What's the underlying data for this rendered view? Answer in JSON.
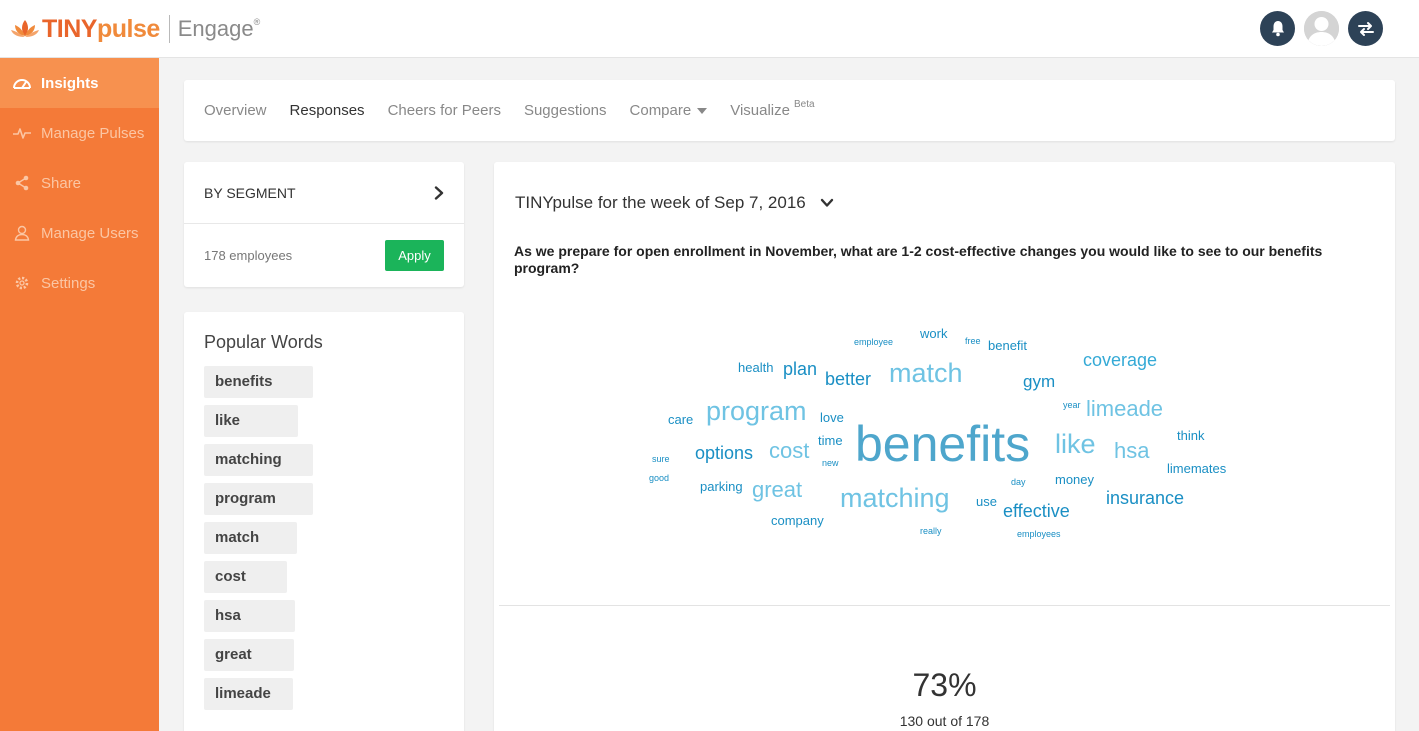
{
  "brand": {
    "tiny": "TINY",
    "pulse": "pulse",
    "product": "Engage",
    "reg": "®"
  },
  "sidebar": {
    "items": [
      {
        "label": "Insights",
        "icon": "gauge-icon"
      },
      {
        "label": "Manage Pulses",
        "icon": "pulse-icon"
      },
      {
        "label": "Share",
        "icon": "share-icon"
      },
      {
        "label": "Manage Users",
        "icon": "user-icon"
      },
      {
        "label": "Settings",
        "icon": "gear-icon"
      }
    ]
  },
  "tabs": [
    {
      "label": "Overview"
    },
    {
      "label": "Responses"
    },
    {
      "label": "Cheers for Peers"
    },
    {
      "label": "Suggestions"
    },
    {
      "label": "Compare"
    },
    {
      "label": "Visualize",
      "sup": "Beta"
    }
  ],
  "segment": {
    "title": "BY SEGMENT",
    "count": "178 employees",
    "apply_label": "Apply"
  },
  "popular_words": {
    "title": "Popular Words",
    "items": [
      "benefits",
      "like",
      "matching",
      "program",
      "match",
      "cost",
      "hsa",
      "great",
      "limeade"
    ]
  },
  "pulse": {
    "week": "TINYpulse for the week of Sep 7, 2016",
    "question": "As we prepare for open enrollment in November, what are 1-2 cost-effective changes you would like to see to our benefits program?",
    "response_rate": "73%",
    "response_count": "130 out of 178"
  },
  "word_cloud": {
    "colors": {
      "dark": "#1a8fc4",
      "mid": "#35aad6",
      "light": "#6fc3e3",
      "hero": "#4ea6cc"
    },
    "words": [
      {
        "text": "benefits",
        "size": 50
      },
      {
        "text": "match",
        "size": 27
      },
      {
        "text": "program",
        "size": 27
      },
      {
        "text": "matching",
        "size": 27
      },
      {
        "text": "like",
        "size": 27
      },
      {
        "text": "cost",
        "size": 22
      },
      {
        "text": "hsa",
        "size": 22
      },
      {
        "text": "limeade",
        "size": 22
      },
      {
        "text": "great",
        "size": 22
      },
      {
        "text": "coverage",
        "size": 18
      },
      {
        "text": "insurance",
        "size": 18
      },
      {
        "text": "better",
        "size": 18
      },
      {
        "text": "options",
        "size": 18
      },
      {
        "text": "plan",
        "size": 18
      },
      {
        "text": "effective",
        "size": 18
      },
      {
        "text": "gym",
        "size": 17
      },
      {
        "text": "health",
        "size": 13
      },
      {
        "text": "work",
        "size": 13
      },
      {
        "text": "benefit",
        "size": 13
      },
      {
        "text": "love",
        "size": 13
      },
      {
        "text": "time",
        "size": 13
      },
      {
        "text": "care",
        "size": 13
      },
      {
        "text": "think",
        "size": 13
      },
      {
        "text": "limemates",
        "size": 13
      },
      {
        "text": "money",
        "size": 13
      },
      {
        "text": "parking",
        "size": 13
      },
      {
        "text": "company",
        "size": 13
      },
      {
        "text": "use",
        "size": 13
      },
      {
        "text": "employee",
        "size": 9
      },
      {
        "text": "free",
        "size": 9
      },
      {
        "text": "year",
        "size": 9
      },
      {
        "text": "sure",
        "size": 9
      },
      {
        "text": "good",
        "size": 9
      },
      {
        "text": "new",
        "size": 9
      },
      {
        "text": "day",
        "size": 9
      },
      {
        "text": "really",
        "size": 9
      },
      {
        "text": "employees",
        "size": 9
      }
    ]
  }
}
